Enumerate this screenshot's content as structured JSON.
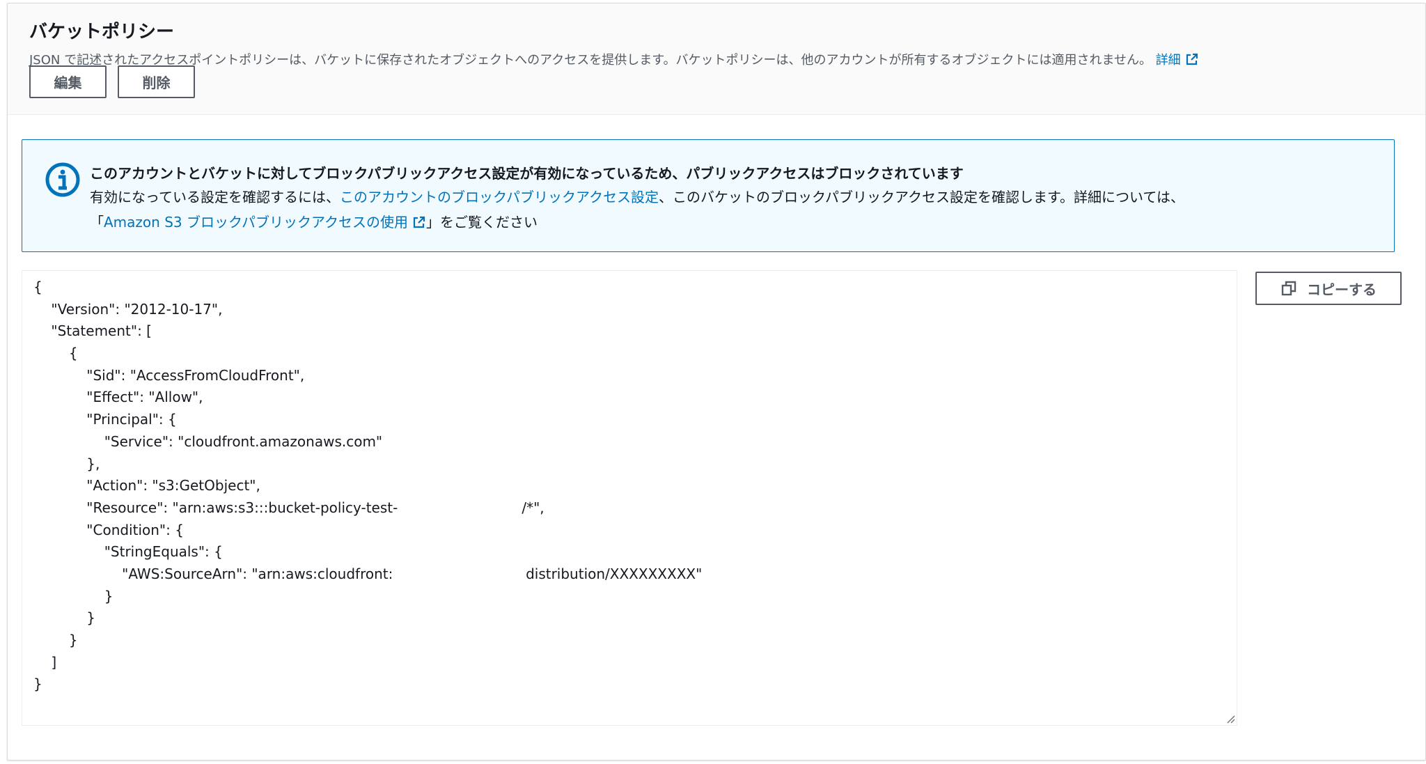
{
  "header": {
    "title": "バケットポリシー",
    "description": "JSON で記述されたアクセスポイントポリシーは、バケットに保存されたオブジェクトへのアクセスを提供します。バケットポリシーは、他のアカウントが所有するオブジェクトには適用されません。",
    "details_link": "詳細",
    "edit_label": "編集",
    "delete_label": "削除"
  },
  "info": {
    "title": "このアカウントとバケットに対してブロックパブリックアクセス設定が有効になっているため、パブリックアクセスはブロックされています",
    "body_prefix": "有効になっている設定を確認するには、",
    "account_link": "このアカウントのブロックパブリックアクセス設定",
    "body_middle": "、このバケットのブロックパブリックアクセス設定を確認します。詳細については、",
    "quote_open": "「",
    "docs_link": "Amazon S3 ブロックパブリックアクセスの使用",
    "body_suffix": "」をご覧ください"
  },
  "policy": {
    "lines": [
      "{",
      "    \"Version\": \"2012-10-17\",",
      "    \"Statement\": [",
      "        {",
      "            \"Sid\": \"AccessFromCloudFront\",",
      "            \"Effect\": \"Allow\",",
      "            \"Principal\": {",
      "                \"Service\": \"cloudfront.amazonaws.com\"",
      "            },",
      "            \"Action\": \"s3:GetObject\",",
      "            \"Resource\": \"arn:aws:s3:::bucket-policy-test-                            /*\",",
      "            \"Condition\": {",
      "                \"StringEquals\": {",
      "                    \"AWS:SourceArn\": \"arn:aws:cloudfront:                              distribution/XXXXXXXXX\"",
      "                }",
      "            }",
      "        }",
      "    ]",
      "}"
    ]
  },
  "copy_label": "コピーする",
  "colors": {
    "link": "#0073bb",
    "info_border": "#0073bb",
    "info_bg": "#f1faff",
    "button_border": "#545b64"
  },
  "icons": {
    "info": "info-icon",
    "external": "external-link-icon",
    "copy": "copy-icon",
    "resize": "resize-handle-icon"
  }
}
